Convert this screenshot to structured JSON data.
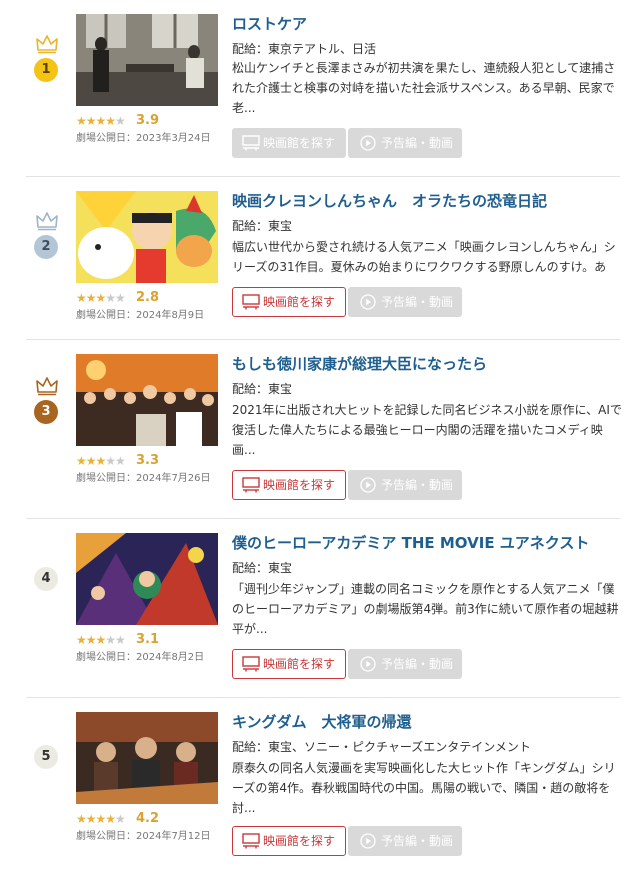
{
  "labels": {
    "find_theater": "映画館を探す",
    "trailer": "予告編・動画"
  },
  "colors": {
    "gold": "#f3c316",
    "silver": "#b4c6d6",
    "bronze": "#a9641f",
    "plain_badge": "#ecebe2",
    "title_blue": "#1f5f8f",
    "star": "#e8b23a",
    "theater_red": "#c9393b",
    "disabled_gray": "#d9d9d9"
  },
  "items": [
    {
      "rank": "1",
      "crown": "gold",
      "title": "ロストケア",
      "distributor": "配給：東京テアトル、日活",
      "synopsis": "松山ケンイチと長澤まさみが初共演を果たし、連続殺人犯として逮捕された介護士と検事の対峙を描いた社会派サスペンス。ある早朝、民家で老...",
      "rating": 3.9,
      "stars": "★★★★",
      "stars_off": "★",
      "score": "3.9",
      "release": "劇場公開日：2023年3月24日",
      "theater_enabled": false
    },
    {
      "rank": "2",
      "crown": "silver",
      "title": "映画クレヨンしんちゃん　オラたちの恐竜日記",
      "distributor": "配給：東宝",
      "synopsis": "幅広い世代から愛され続ける人気アニメ「映画クレヨンしんちゃん」シリーズの31作目。夏休みの始まりにワクワクする野原しんのすけ。ある...",
      "rating": 2.8,
      "stars": "★★★",
      "stars_off": "★★",
      "score": "2.8",
      "release": "劇場公開日：2024年8月9日",
      "theater_enabled": true
    },
    {
      "rank": "3",
      "crown": "bronze",
      "title": "もしも徳川家康が総理大臣になったら",
      "distributor": "配給：東宝",
      "synopsis": "2021年に出版され大ヒットを記録した同名ビジネス小説を原作に、AIで復活した偉人たちによる最強ヒーロー内閣の活躍を描いたコメディ映画...",
      "rating": 3.3,
      "stars": "★★★",
      "stars_off": "★★",
      "score": "3.3",
      "release": "劇場公開日：2024年7月26日",
      "theater_enabled": true
    },
    {
      "rank": "4",
      "crown": "",
      "title": "僕のヒーローアカデミア THE MOVIE ユアネクスト",
      "distributor": "配給：東宝",
      "synopsis": "「週刊少年ジャンプ」連載の同名コミックを原作とする人気アニメ「僕のヒーローアカデミア」の劇場版第4弾。前3作に続いて原作者の堀越耕平が...",
      "rating": 3.1,
      "stars": "★★★",
      "stars_off": "★★",
      "score": "3.1",
      "release": "劇場公開日：2024年8月2日",
      "theater_enabled": true
    },
    {
      "rank": "5",
      "crown": "",
      "title": "キングダム　大将軍の帰還",
      "distributor": "配給：東宝、ソニー・ピクチャーズエンタテインメント",
      "synopsis": "原泰久の同名人気漫画を実写映画化した大ヒット作「キングダム」シリーズの第4作。春秋戦国時代の中国。馬陽の戦いで、隣国・趙の敵将を討...",
      "rating": 4.2,
      "stars": "★★★★",
      "stars_off": "★",
      "score": "4.2",
      "release": "劇場公開日：2024年7月12日",
      "theater_enabled": true
    }
  ]
}
